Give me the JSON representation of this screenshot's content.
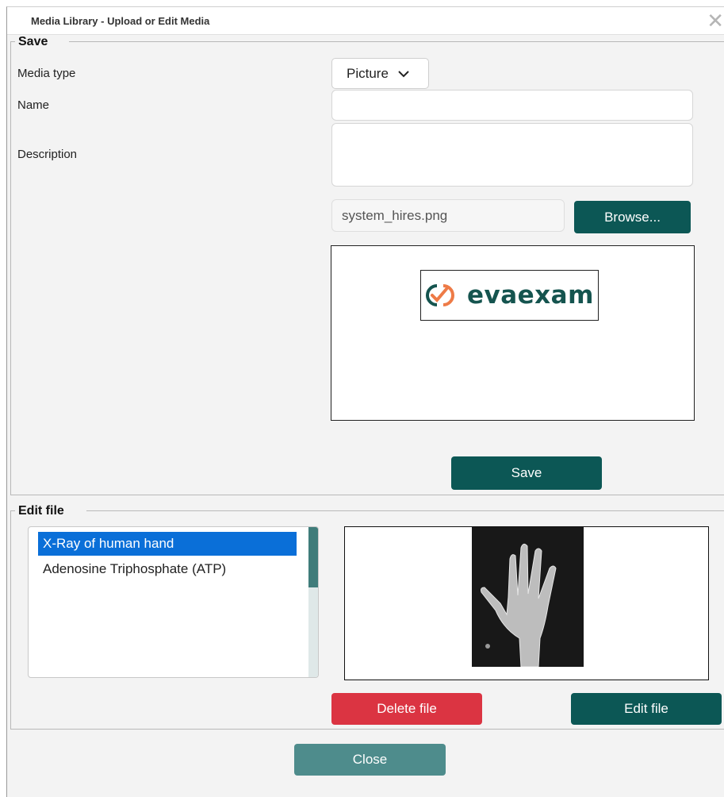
{
  "dialog": {
    "title": "Media Library - Upload or Edit Media",
    "close_glyph": "✕"
  },
  "save_section": {
    "legend": "Save",
    "media_type_label": "Media type",
    "media_type_value": "Picture",
    "name_label": "Name",
    "name_value": "",
    "description_label": "Description",
    "description_value": "",
    "file_name": "system_hires.png",
    "browse_label": "Browse...",
    "preview_logo_text": "evaexam",
    "save_label": "Save"
  },
  "edit_section": {
    "legend": "Edit file",
    "items": [
      {
        "label": "X-Ray of human hand",
        "selected": true
      },
      {
        "label": "Adenosine Triphosphate (ATP)",
        "selected": false
      }
    ],
    "delete_label": "Delete file",
    "edit_label": "Edit file"
  },
  "footer": {
    "close_label": "Close"
  },
  "colors": {
    "brand_dark": "#0c5755",
    "danger": "#db3442",
    "close_button": "#4e8c8c",
    "selection": "#0a6fd8",
    "logo_orange": "#ee7b47"
  },
  "icons": {
    "chevron": "chevron-down-icon",
    "logo": "evaexam-logo-icon",
    "close": "close-icon"
  }
}
